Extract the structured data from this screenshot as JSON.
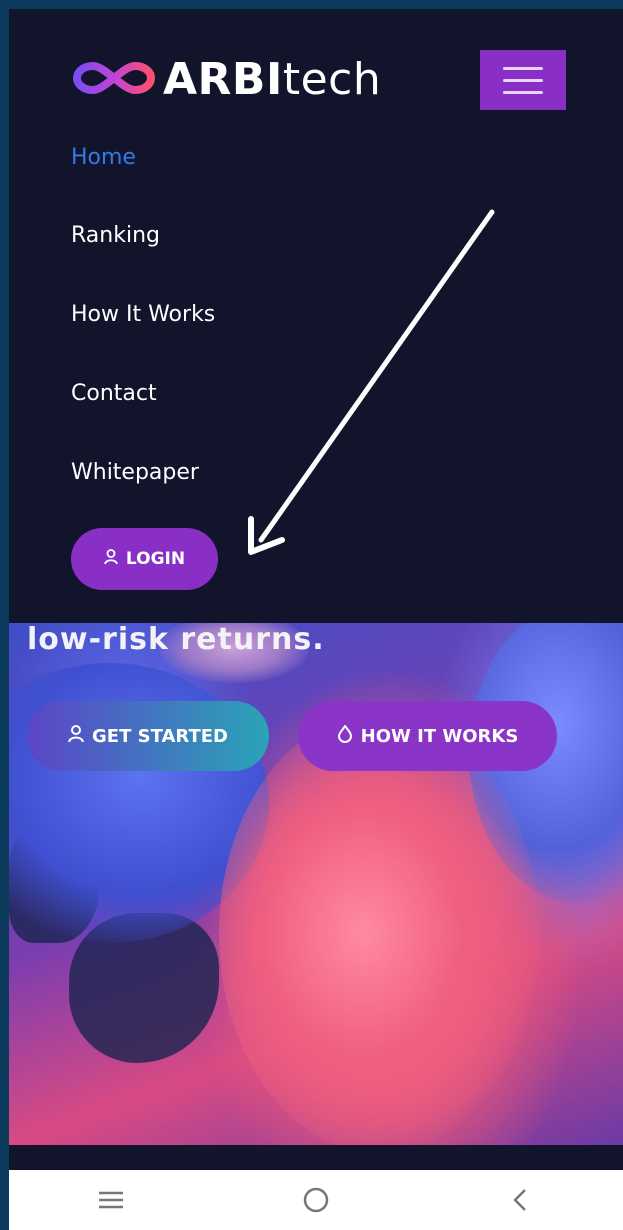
{
  "header": {
    "logo_bold": "ARBI",
    "logo_light": "tech",
    "brand_color": "#8a2fc6"
  },
  "menu": {
    "items": [
      {
        "label": "Home",
        "active": true
      },
      {
        "label": "Ranking"
      },
      {
        "label": "How It Works"
      },
      {
        "label": "Contact"
      },
      {
        "label": "Whitepaper"
      }
    ],
    "login_label": "LOGIN",
    "login_icon": "user-icon"
  },
  "hero": {
    "text": "low-risk returns.",
    "get_started_label": "GET STARTED",
    "get_started_icon": "user-icon",
    "how_it_works_label": "HOW IT WORKS",
    "how_it_works_icon": "flame-icon"
  },
  "system_nav": {
    "icons": [
      "recent-apps-icon",
      "home-icon",
      "back-icon"
    ]
  }
}
